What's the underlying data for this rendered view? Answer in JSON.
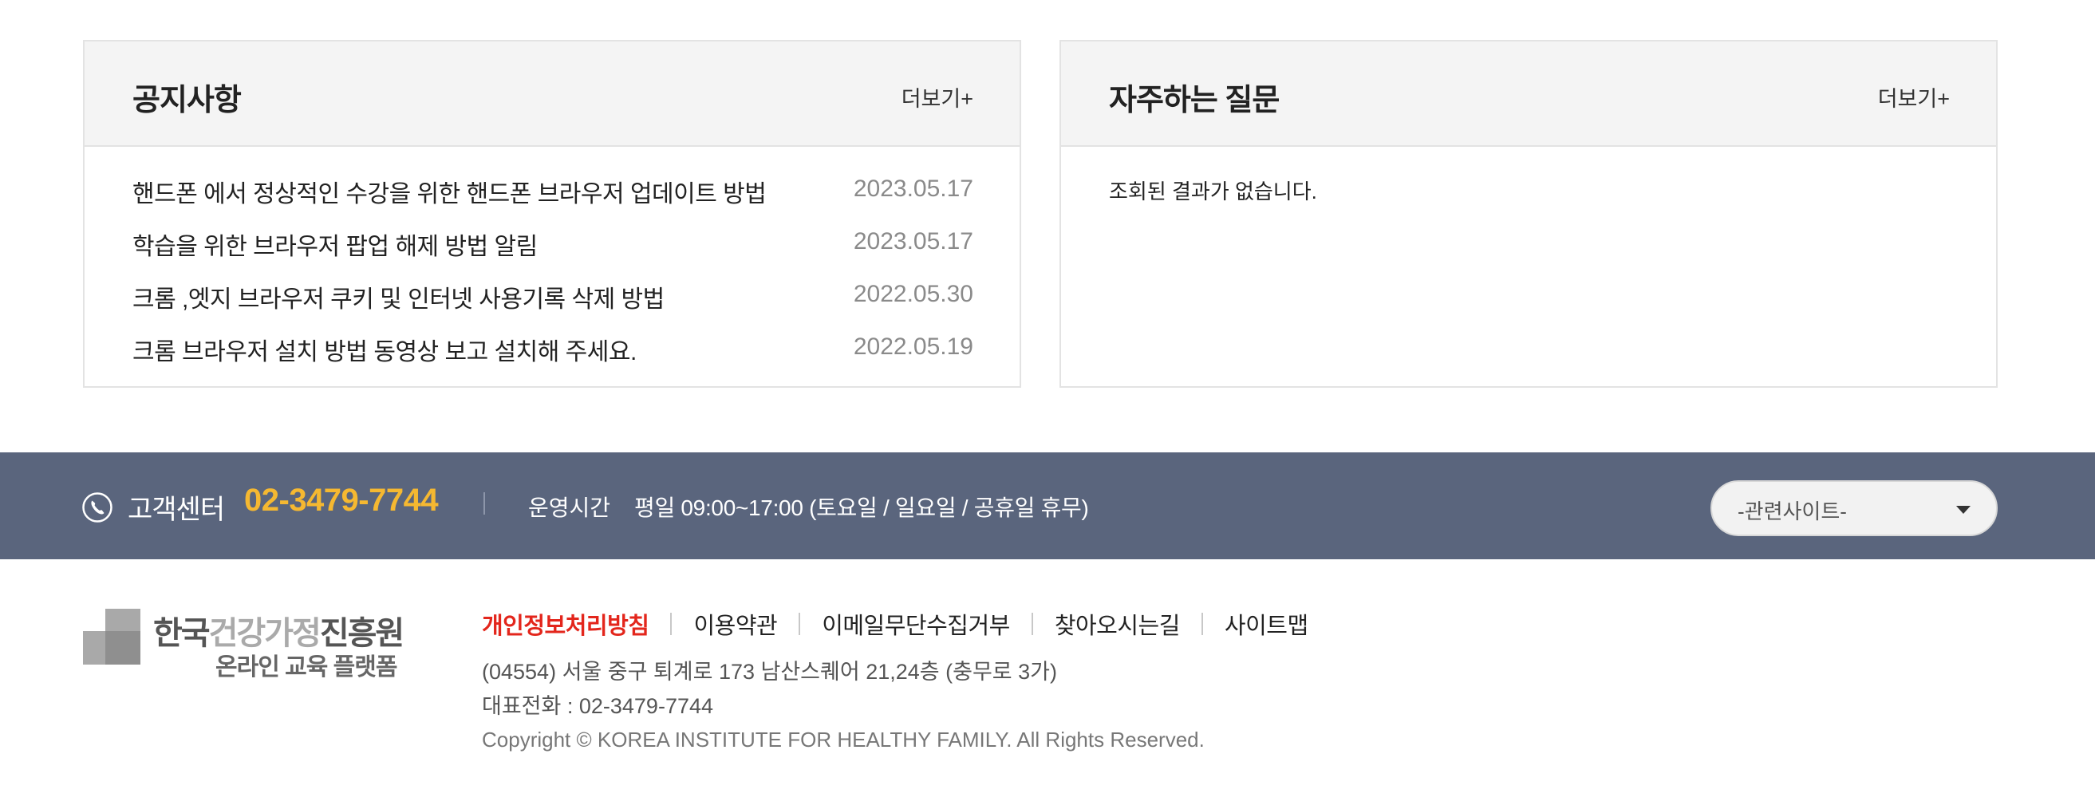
{
  "notice": {
    "title": "공지사항",
    "more_label": "더보기+",
    "items": [
      {
        "title": "핸드폰 에서 정상적인 수강을 위한 핸드폰 브라우저 업데이트 방법",
        "date": "2023.05.17"
      },
      {
        "title": "학습을 위한 브라우저 팝업 해제 방법 알림",
        "date": "2023.05.17"
      },
      {
        "title": "크롬 ,엣지 브라우저 쿠키 및 인터넷 사용기록 삭제 방법",
        "date": "2022.05.30"
      },
      {
        "title": "크롬 브라우저 설치 방법 동영상 보고 설치해 주세요.",
        "date": "2022.05.19"
      }
    ]
  },
  "faq": {
    "title": "자주하는 질문",
    "more_label": "더보기+",
    "empty_text": "조회된 결과가 없습니다."
  },
  "customer_center": {
    "label": "고객센터",
    "phone": "02-3479-7744",
    "hours_label": "운영시간",
    "hours": "평일 09:00~17:00 (토요일 / 일요일 / 공휴일 휴무)",
    "icon": "phone-icon",
    "related_sites_label": "-관련사이트-"
  },
  "footer": {
    "logo": {
      "line1_part1": "한국",
      "line1_part2": "건강가정",
      "line1_part3": "진흥원",
      "line2": "온라인 교육 플랫폼"
    },
    "links": [
      "개인정보처리방침",
      "이용약관",
      "이메일무단수집거부",
      "찾아오시는길",
      "사이트맵"
    ],
    "address": "(04554) 서울 중구 퇴계로 173 남산스퀘어 21,24층 (충무로 3가)",
    "tel": "대표전화 : 02-3479-7744",
    "copyright": "Copyright © KOREA INSTITUTE FOR HEALTHY FAMILY. All Rights Reserved."
  },
  "colors": {
    "accent_yellow": "#f5b831",
    "privacy_red": "#e3261c",
    "bar_background": "#5a657d"
  }
}
